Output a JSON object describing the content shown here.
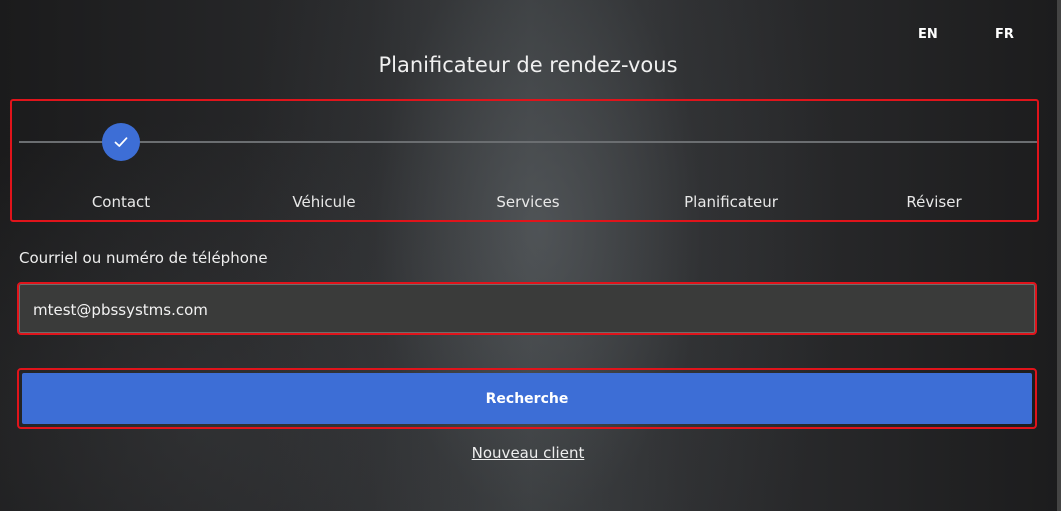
{
  "language": {
    "en_label": "EN",
    "fr_label": "FR"
  },
  "header": {
    "title": "Planificateur de rendez-vous"
  },
  "stepper": {
    "steps": [
      {
        "label": "Contact",
        "completed": true
      },
      {
        "label": "Véhicule",
        "completed": false
      },
      {
        "label": "Services",
        "completed": false
      },
      {
        "label": "Planificateur",
        "completed": false
      },
      {
        "label": "Réviser",
        "completed": false
      }
    ],
    "completed_icon": "check-icon"
  },
  "form": {
    "contact_label": "Courriel ou numéro de téléphone",
    "contact_value": "mtest@pbssystms.com",
    "search_button_label": "Recherche",
    "new_client_link": "Nouveau client"
  },
  "colors": {
    "accent": "#3d6ed6",
    "highlight_border": "#e0141b",
    "background": "#1e1f20"
  }
}
